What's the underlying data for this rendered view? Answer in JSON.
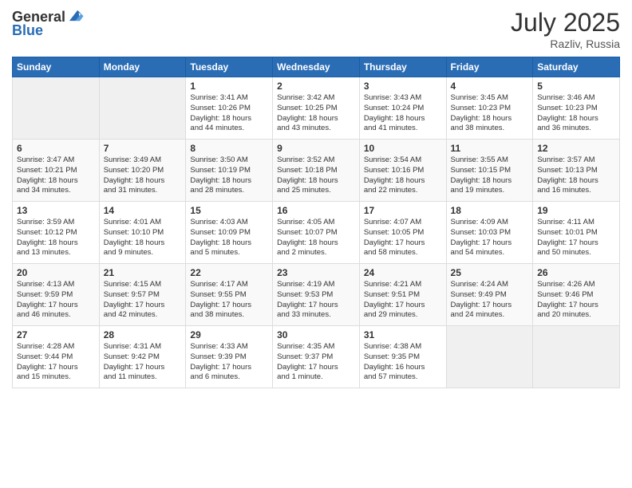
{
  "logo": {
    "general": "General",
    "blue": "Blue"
  },
  "header": {
    "month": "July 2025",
    "location": "Razliv, Russia"
  },
  "days_of_week": [
    "Sunday",
    "Monday",
    "Tuesday",
    "Wednesday",
    "Thursday",
    "Friday",
    "Saturday"
  ],
  "weeks": [
    [
      {
        "day": "",
        "info": ""
      },
      {
        "day": "",
        "info": ""
      },
      {
        "day": "1",
        "info": "Sunrise: 3:41 AM\nSunset: 10:26 PM\nDaylight: 18 hours\nand 44 minutes."
      },
      {
        "day": "2",
        "info": "Sunrise: 3:42 AM\nSunset: 10:25 PM\nDaylight: 18 hours\nand 43 minutes."
      },
      {
        "day": "3",
        "info": "Sunrise: 3:43 AM\nSunset: 10:24 PM\nDaylight: 18 hours\nand 41 minutes."
      },
      {
        "day": "4",
        "info": "Sunrise: 3:45 AM\nSunset: 10:23 PM\nDaylight: 18 hours\nand 38 minutes."
      },
      {
        "day": "5",
        "info": "Sunrise: 3:46 AM\nSunset: 10:23 PM\nDaylight: 18 hours\nand 36 minutes."
      }
    ],
    [
      {
        "day": "6",
        "info": "Sunrise: 3:47 AM\nSunset: 10:21 PM\nDaylight: 18 hours\nand 34 minutes."
      },
      {
        "day": "7",
        "info": "Sunrise: 3:49 AM\nSunset: 10:20 PM\nDaylight: 18 hours\nand 31 minutes."
      },
      {
        "day": "8",
        "info": "Sunrise: 3:50 AM\nSunset: 10:19 PM\nDaylight: 18 hours\nand 28 minutes."
      },
      {
        "day": "9",
        "info": "Sunrise: 3:52 AM\nSunset: 10:18 PM\nDaylight: 18 hours\nand 25 minutes."
      },
      {
        "day": "10",
        "info": "Sunrise: 3:54 AM\nSunset: 10:16 PM\nDaylight: 18 hours\nand 22 minutes."
      },
      {
        "day": "11",
        "info": "Sunrise: 3:55 AM\nSunset: 10:15 PM\nDaylight: 18 hours\nand 19 minutes."
      },
      {
        "day": "12",
        "info": "Sunrise: 3:57 AM\nSunset: 10:13 PM\nDaylight: 18 hours\nand 16 minutes."
      }
    ],
    [
      {
        "day": "13",
        "info": "Sunrise: 3:59 AM\nSunset: 10:12 PM\nDaylight: 18 hours\nand 13 minutes."
      },
      {
        "day": "14",
        "info": "Sunrise: 4:01 AM\nSunset: 10:10 PM\nDaylight: 18 hours\nand 9 minutes."
      },
      {
        "day": "15",
        "info": "Sunrise: 4:03 AM\nSunset: 10:09 PM\nDaylight: 18 hours\nand 5 minutes."
      },
      {
        "day": "16",
        "info": "Sunrise: 4:05 AM\nSunset: 10:07 PM\nDaylight: 18 hours\nand 2 minutes."
      },
      {
        "day": "17",
        "info": "Sunrise: 4:07 AM\nSunset: 10:05 PM\nDaylight: 17 hours\nand 58 minutes."
      },
      {
        "day": "18",
        "info": "Sunrise: 4:09 AM\nSunset: 10:03 PM\nDaylight: 17 hours\nand 54 minutes."
      },
      {
        "day": "19",
        "info": "Sunrise: 4:11 AM\nSunset: 10:01 PM\nDaylight: 17 hours\nand 50 minutes."
      }
    ],
    [
      {
        "day": "20",
        "info": "Sunrise: 4:13 AM\nSunset: 9:59 PM\nDaylight: 17 hours\nand 46 minutes."
      },
      {
        "day": "21",
        "info": "Sunrise: 4:15 AM\nSunset: 9:57 PM\nDaylight: 17 hours\nand 42 minutes."
      },
      {
        "day": "22",
        "info": "Sunrise: 4:17 AM\nSunset: 9:55 PM\nDaylight: 17 hours\nand 38 minutes."
      },
      {
        "day": "23",
        "info": "Sunrise: 4:19 AM\nSunset: 9:53 PM\nDaylight: 17 hours\nand 33 minutes."
      },
      {
        "day": "24",
        "info": "Sunrise: 4:21 AM\nSunset: 9:51 PM\nDaylight: 17 hours\nand 29 minutes."
      },
      {
        "day": "25",
        "info": "Sunrise: 4:24 AM\nSunset: 9:49 PM\nDaylight: 17 hours\nand 24 minutes."
      },
      {
        "day": "26",
        "info": "Sunrise: 4:26 AM\nSunset: 9:46 PM\nDaylight: 17 hours\nand 20 minutes."
      }
    ],
    [
      {
        "day": "27",
        "info": "Sunrise: 4:28 AM\nSunset: 9:44 PM\nDaylight: 17 hours\nand 15 minutes."
      },
      {
        "day": "28",
        "info": "Sunrise: 4:31 AM\nSunset: 9:42 PM\nDaylight: 17 hours\nand 11 minutes."
      },
      {
        "day": "29",
        "info": "Sunrise: 4:33 AM\nSunset: 9:39 PM\nDaylight: 17 hours\nand 6 minutes."
      },
      {
        "day": "30",
        "info": "Sunrise: 4:35 AM\nSunset: 9:37 PM\nDaylight: 17 hours\nand 1 minute."
      },
      {
        "day": "31",
        "info": "Sunrise: 4:38 AM\nSunset: 9:35 PM\nDaylight: 16 hours\nand 57 minutes."
      },
      {
        "day": "",
        "info": ""
      },
      {
        "day": "",
        "info": ""
      }
    ]
  ]
}
